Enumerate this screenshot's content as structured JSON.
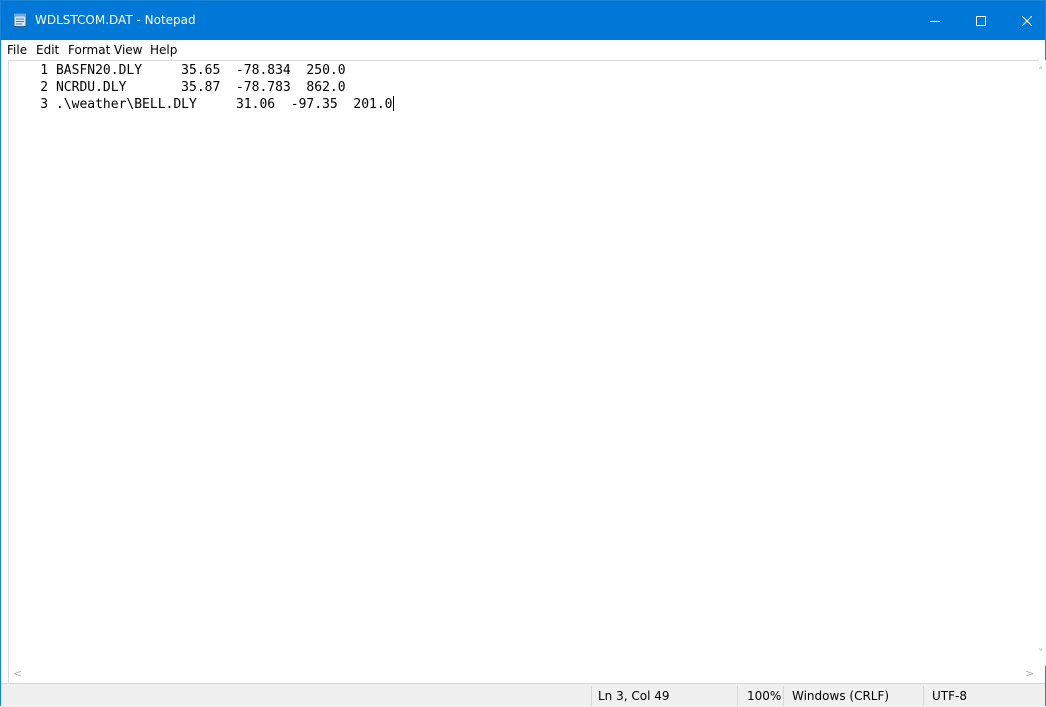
{
  "window": {
    "title": "WDLSTCOM.DAT - Notepad",
    "accent_color": "#0078d7",
    "controls": {
      "minimize_icon": "minimize-icon",
      "maximize_icon": "maximize-icon",
      "close_icon": "close-icon"
    }
  },
  "menu": {
    "items": [
      "File",
      "Edit",
      "Format",
      "View",
      "Help"
    ]
  },
  "document": {
    "lines": [
      "    1 BASFN20.DLY     35.65  -78.834  250.0",
      "    2 NCRDU.DLY       35.87  -78.783  862.0",
      "    3 .\\weather\\BELL.DLY     31.06  -97.35  201.0"
    ]
  },
  "status": {
    "position": "Ln 3, Col 49",
    "zoom": "100%",
    "line_ending": "Windows (CRLF)",
    "encoding": "UTF-8"
  }
}
